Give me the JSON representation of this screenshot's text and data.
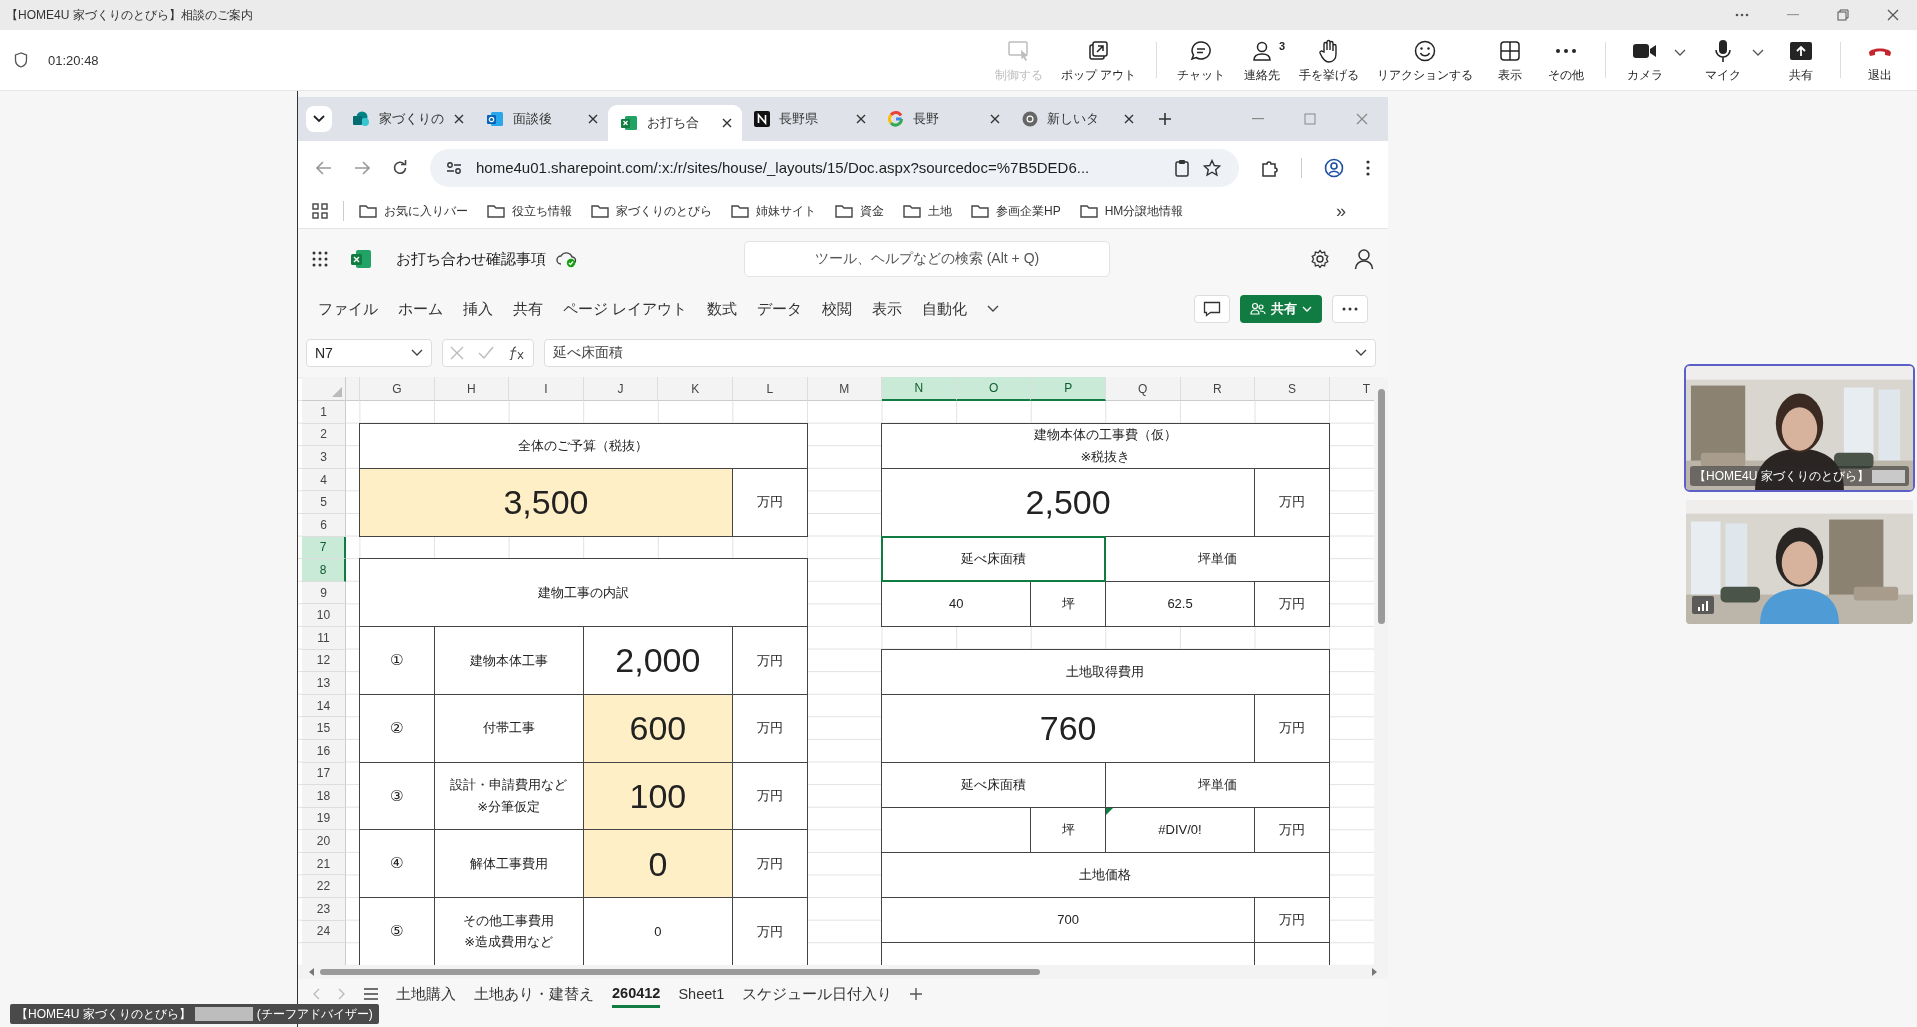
{
  "meeting": {
    "title": "【HOME4U 家づくりのとびら】相談のご案内",
    "timer": "01:20:48",
    "toolbar": [
      {
        "kind": "control",
        "label": "制御する",
        "disabled": true,
        "dropdown": false
      },
      {
        "kind": "popout",
        "label": "ポップ アウト",
        "disabled": false,
        "dropdown": false
      },
      {
        "kind": "separator"
      },
      {
        "kind": "chat",
        "label": "チャット",
        "disabled": false,
        "dropdown": false
      },
      {
        "kind": "people",
        "label": "連絡先",
        "badge": "3",
        "disabled": false,
        "dropdown": false
      },
      {
        "kind": "hand",
        "label": "手を挙げる",
        "disabled": false,
        "dropdown": false
      },
      {
        "kind": "smile",
        "label": "リアクションする",
        "disabled": false,
        "dropdown": false
      },
      {
        "kind": "layout",
        "label": "表示",
        "disabled": false,
        "dropdown": false
      },
      {
        "kind": "more",
        "label": "その他",
        "disabled": false,
        "dropdown": false
      },
      {
        "kind": "separator"
      },
      {
        "kind": "camera",
        "label": "カメラ",
        "disabled": false,
        "dropdown": true
      },
      {
        "kind": "mic",
        "label": "マイク",
        "disabled": false,
        "dropdown": true
      },
      {
        "kind": "share",
        "label": "共有",
        "disabled": false,
        "dropdown": false
      },
      {
        "kind": "separator"
      },
      {
        "kind": "leave",
        "label": "退出",
        "disabled": false,
        "dropdown": false
      }
    ]
  },
  "browser": {
    "tabs": [
      {
        "label": "家づくりの",
        "selected": false
      },
      {
        "label": "面談後",
        "selected": false
      },
      {
        "label": "お打ち合",
        "selected": true
      },
      {
        "label": "長野県",
        "selected": false
      },
      {
        "label": "長野",
        "selected": false
      },
      {
        "label": "新しいタ",
        "selected": false
      }
    ],
    "url": "home4u01.sharepoint.com/:x:/r/sites/house/_layouts/15/Doc.aspx?sourcedoc=%7B5DED6...",
    "bookmarks": [
      "お気に入りバー",
      "役立ち情報",
      "家づくりのとびら",
      "姉妹サイト",
      "資金",
      "土地",
      "参画企業HP",
      "HM分譲地情報"
    ],
    "bookmarks_more": "»"
  },
  "excel": {
    "title": "お打ち合わせ確認事項",
    "search_placeholder": "ツール、ヘルプなどの検索 (Alt + Q)",
    "ribbon_tabs": [
      "ファイル",
      "ホーム",
      "挿入",
      "共有",
      "ページ レイアウト",
      "数式",
      "データ",
      "校閲",
      "表示",
      "自動化"
    ],
    "share_button": "共有",
    "name_box": "N7",
    "formula": "延べ床面積",
    "columns": [
      {
        "label": "G",
        "selected": false
      },
      {
        "label": "H",
        "selected": false
      },
      {
        "label": "I",
        "selected": false
      },
      {
        "label": "J",
        "selected": false
      },
      {
        "label": "K",
        "selected": false
      },
      {
        "label": "L",
        "selected": false
      },
      {
        "label": "M",
        "selected": false
      },
      {
        "label": "N",
        "selected": true
      },
      {
        "label": "O",
        "selected": true
      },
      {
        "label": "P",
        "selected": true
      },
      {
        "label": "Q",
        "selected": false
      },
      {
        "label": "R",
        "selected": false
      },
      {
        "label": "S",
        "selected": false
      },
      {
        "label": "T",
        "selected": false
      }
    ],
    "rows": [
      {
        "label": "1",
        "selected": false
      },
      {
        "label": "2",
        "selected": false
      },
      {
        "label": "3",
        "selected": false
      },
      {
        "label": "4",
        "selected": false
      },
      {
        "label": "5",
        "selected": false
      },
      {
        "label": "6",
        "selected": false
      },
      {
        "label": "7",
        "selected": true
      },
      {
        "label": "8",
        "selected": true
      },
      {
        "label": "9",
        "selected": false
      },
      {
        "label": "10",
        "selected": false
      },
      {
        "label": "11",
        "selected": false
      },
      {
        "label": "12",
        "selected": false
      },
      {
        "label": "13",
        "selected": false
      },
      {
        "label": "14",
        "selected": false
      },
      {
        "label": "15",
        "selected": false
      },
      {
        "label": "16",
        "selected": false
      },
      {
        "label": "17",
        "selected": false
      },
      {
        "label": "18",
        "selected": false
      },
      {
        "label": "19",
        "selected": false
      },
      {
        "label": "20",
        "selected": false
      },
      {
        "label": "21",
        "selected": false
      },
      {
        "label": "22",
        "selected": false
      },
      {
        "label": "23",
        "selected": false
      },
      {
        "label": "24",
        "selected": false
      }
    ],
    "cells": [
      {
        "kind": "title",
        "text": "全体のご予算（税抜）",
        "highlighted": false,
        "selected": false
      },
      {
        "kind": "big",
        "text": "3,500",
        "highlighted": true,
        "selected": false
      },
      {
        "kind": "unit",
        "text": "万円",
        "highlighted": false,
        "selected": false
      },
      {
        "kind": "title",
        "text": "建物工事の内訳",
        "highlighted": false,
        "selected": false
      },
      {
        "kind": "mark",
        "text": "①",
        "highlighted": false,
        "selected": false
      },
      {
        "kind": "label",
        "text": "建物本体工事",
        "highlighted": false,
        "selected": false
      },
      {
        "kind": "big",
        "text": "2,000",
        "highlighted": false,
        "selected": false
      },
      {
        "kind": "unit",
        "text": "万円",
        "highlighted": false,
        "selected": false
      },
      {
        "kind": "mark",
        "text": "②",
        "highlighted": false,
        "selected": false
      },
      {
        "kind": "label",
        "text": "付帯工事",
        "highlighted": false,
        "selected": false
      },
      {
        "kind": "big",
        "text": "600",
        "highlighted": true,
        "selected": false
      },
      {
        "kind": "unit",
        "text": "万円",
        "highlighted": false,
        "selected": false
      },
      {
        "kind": "mark",
        "text": "③",
        "highlighted": false,
        "selected": false
      },
      {
        "kind": "label",
        "text": "設計・申請費用など\n※分筆仮定",
        "highlighted": false,
        "selected": false
      },
      {
        "kind": "big",
        "text": "100",
        "highlighted": true,
        "selected": false
      },
      {
        "kind": "unit",
        "text": "万円",
        "highlighted": false,
        "selected": false
      },
      {
        "kind": "mark",
        "text": "④",
        "highlighted": false,
        "selected": false
      },
      {
        "kind": "label",
        "text": "解体工事費用",
        "highlighted": false,
        "selected": false
      },
      {
        "kind": "big",
        "text": "0",
        "highlighted": true,
        "selected": false
      },
      {
        "kind": "unit",
        "text": "万円",
        "highlighted": false,
        "selected": false
      },
      {
        "kind": "mark",
        "text": "⑤",
        "highlighted": false,
        "selected": false
      },
      {
        "kind": "label",
        "text": "その他工事費用\n※造成費用など",
        "highlighted": false,
        "selected": false
      },
      {
        "kind": "value",
        "text": "0",
        "highlighted": false,
        "selected": false
      },
      {
        "kind": "unit",
        "text": "万円",
        "highlighted": false,
        "selected": false
      },
      {
        "kind": "title",
        "text": "建物本体の工事費（仮）\n※税抜き",
        "highlighted": false,
        "selected": false
      },
      {
        "kind": "big",
        "text": "2,500",
        "highlighted": false,
        "selected": false
      },
      {
        "kind": "unit",
        "text": "万円",
        "highlighted": false,
        "selected": false
      },
      {
        "kind": "label",
        "text": "延べ床面積",
        "highlighted": false,
        "selected": true
      },
      {
        "kind": "label",
        "text": "坪単価",
        "highlighted": false,
        "selected": false
      },
      {
        "kind": "value",
        "text": "40",
        "highlighted": false,
        "selected": false
      },
      {
        "kind": "unit",
        "text": "坪",
        "highlighted": false,
        "selected": false
      },
      {
        "kind": "value",
        "text": "62.5",
        "highlighted": false,
        "selected": false
      },
      {
        "kind": "unit",
        "text": "万円",
        "highlighted": false,
        "selected": false
      },
      {
        "kind": "title",
        "text": "土地取得費用",
        "highlighted": false,
        "selected": false
      },
      {
        "kind": "big",
        "text": "760",
        "highlighted": false,
        "selected": false
      },
      {
        "kind": "unit",
        "text": "万円",
        "highlighted": false,
        "selected": false
      },
      {
        "kind": "label",
        "text": "延べ床面積",
        "highlighted": false,
        "selected": false
      },
      {
        "kind": "label",
        "text": "坪単価",
        "highlighted": false,
        "selected": false
      },
      {
        "kind": "unit",
        "text": "坪",
        "highlighted": false,
        "selected": false
      },
      {
        "kind": "error",
        "text": "#DIV/0!",
        "highlighted": false,
        "selected": false
      },
      {
        "kind": "unit",
        "text": "万円",
        "highlighted": false,
        "selected": false
      },
      {
        "kind": "title",
        "text": "土地価格",
        "highlighted": false,
        "selected": false
      },
      {
        "kind": "value",
        "text": "700",
        "highlighted": false,
        "selected": false
      },
      {
        "kind": "unit",
        "text": "万円",
        "highlighted": false,
        "selected": false
      }
    ],
    "sheet_tabs": [
      {
        "label": "土地購入",
        "selected": false
      },
      {
        "label": "土地あり・建替え",
        "selected": false
      },
      {
        "label": "260412",
        "selected": true
      },
      {
        "label": "Sheet1",
        "selected": false
      },
      {
        "label": "スケジュール日付入り",
        "selected": false
      }
    ]
  },
  "participants": [
    {
      "label": "【HOME4U 家づくりのとびら】",
      "active": true
    },
    {
      "active": false
    }
  ],
  "presenter": {
    "org": "【HOME4U 家づくりのとびら】",
    "role": "(チーフアドバイザー)"
  }
}
